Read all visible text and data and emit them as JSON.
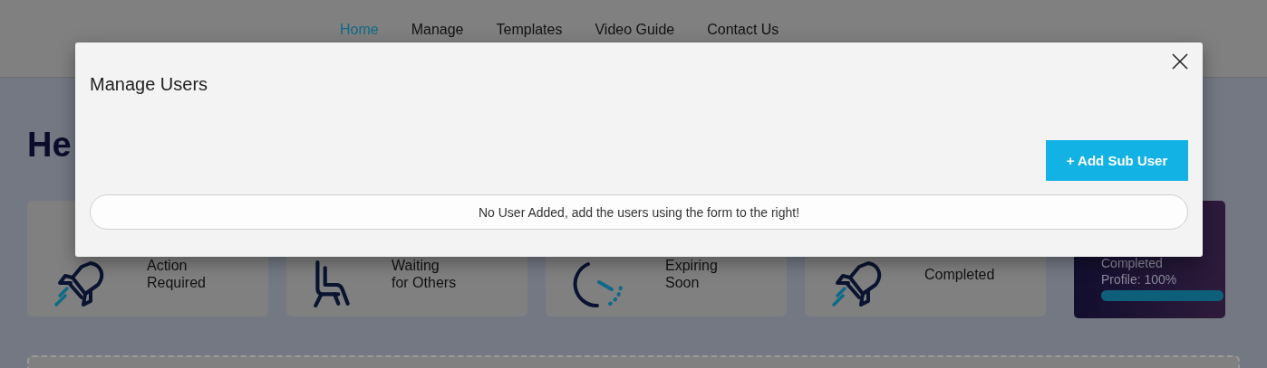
{
  "nav": [
    {
      "label": "Home",
      "selected": true
    },
    {
      "label": "Manage",
      "selected": false
    },
    {
      "label": "Templates",
      "selected": false
    },
    {
      "label": "Video Guide",
      "selected": false
    },
    {
      "label": "Contact Us",
      "selected": false
    }
  ],
  "heading": "He",
  "cards": [
    {
      "kind": "rocket",
      "lines": [
        "Action",
        "Required"
      ]
    },
    {
      "kind": "seat",
      "lines": [
        "Waiting",
        "for Others"
      ]
    },
    {
      "kind": "clock",
      "lines": [
        "Expiring",
        "Soon"
      ]
    },
    {
      "kind": "rocket",
      "lines": [
        "Completed"
      ]
    }
  ],
  "profile": {
    "lines": [
      "Completed",
      "Profile: 100%"
    ],
    "level": 1
  },
  "modal": {
    "title": "Manage Users",
    "add_button": "+ Add Sub User",
    "empty_message": "No User Added, add the users using the form to the right!"
  }
}
